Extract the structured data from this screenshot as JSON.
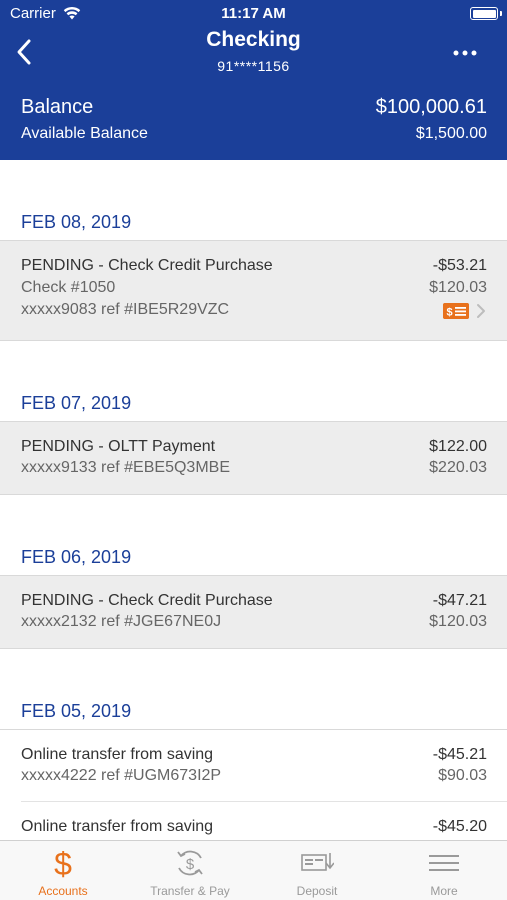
{
  "status_bar": {
    "carrier": "Carrier",
    "time": "11:17 AM"
  },
  "nav": {
    "title": "Checking",
    "account_number": "91****1156"
  },
  "balance": {
    "label": "Balance",
    "value": "$100,000.61",
    "available_label": "Available Balance",
    "available_value": "$1,500.00"
  },
  "groups": [
    {
      "date": "FEB 08, 2019",
      "transactions": [
        {
          "description": "PENDING - Check Credit Purchase",
          "check": "Check #1050",
          "reference": "xxxxx9083 ref #IBE5R29VZC",
          "amount": "-$53.21",
          "balance": "$120.03",
          "has_check_image": true
        }
      ]
    },
    {
      "date": "FEB 07, 2019",
      "transactions": [
        {
          "description": "PENDING - OLTT Payment",
          "reference": "xxxxx9133 ref #EBE5Q3MBE",
          "amount": "$122.00",
          "balance": "$220.03"
        }
      ]
    },
    {
      "date": "FEB 06, 2019",
      "transactions": [
        {
          "description": "PENDING - Check Credit Purchase",
          "reference": "xxxxx2132 ref #JGE67NE0J",
          "amount": "-$47.21",
          "balance": "$120.03"
        }
      ]
    },
    {
      "date": "FEB 05, 2019",
      "transactions": [
        {
          "description": "Online transfer from saving",
          "reference": "xxxxx4222 ref #UGM673I2P",
          "amount": "-$45.21",
          "balance": "$90.03"
        },
        {
          "description": "Online transfer from saving",
          "amount": "-$45.20"
        }
      ]
    }
  ],
  "tabs": [
    {
      "label": "Accounts",
      "icon": "dollar-icon",
      "active": true
    },
    {
      "label": "Transfer & Pay",
      "icon": "transfer-pay-icon",
      "active": false
    },
    {
      "label": "Deposit",
      "icon": "deposit-check-icon",
      "active": false
    },
    {
      "label": "More",
      "icon": "menu-icon",
      "active": false
    }
  ],
  "colors": {
    "header_blue": "#1b3f99",
    "date_blue": "#1b3f99",
    "accent_orange": "#e8711c",
    "pending_row_bg": "#ededed"
  }
}
